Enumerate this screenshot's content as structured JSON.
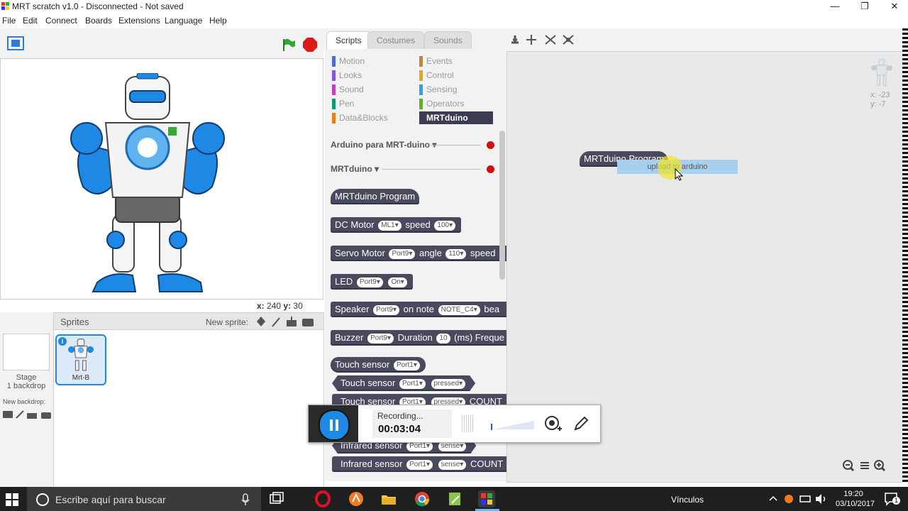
{
  "window": {
    "title": "MRT scratch v1.0 - Disconnected - Not saved",
    "minimize": "—",
    "restore": "❐",
    "close": "✕"
  },
  "menu": [
    "File",
    "Edit",
    "Connect",
    "Boards",
    "Extensions",
    "Language",
    "Help"
  ],
  "stage": {
    "coord_x_label": "x:",
    "coord_x": "240",
    "coord_y_label": "y:",
    "coord_y": "30",
    "sprite_label": "Mrt-B"
  },
  "sprites": {
    "header": "Sprites",
    "new_sprite": "New sprite:",
    "stage_name": "Stage",
    "stage_backdrops": "1 backdrop",
    "new_backdrop": "New backdrop:",
    "sprite_name": "Mrt-B",
    "info_badge": "i"
  },
  "tabs": [
    "Scripts",
    "Costumes",
    "Sounds"
  ],
  "categories_left": [
    {
      "label": "Motion",
      "color": "#4a6cd4"
    },
    {
      "label": "Looks",
      "color": "#8a55d7"
    },
    {
      "label": "Sound",
      "color": "#bb42c3"
    },
    {
      "label": "Pen",
      "color": "#0e9a6c"
    },
    {
      "label": "Data&Blocks",
      "color": "#ee7d16"
    }
  ],
  "categories_right": [
    {
      "label": "Events",
      "color": "#c88330"
    },
    {
      "label": "Control",
      "color": "#e1a91a"
    },
    {
      "label": "Sensing",
      "color": "#2ca5e2"
    },
    {
      "label": "Operators",
      "color": "#5cb712"
    },
    {
      "label": "MRTduino",
      "color": "#3b3b52"
    }
  ],
  "palette": {
    "ext1": "Arduino para MRT-duino ▾",
    "ext2": "MRTduino ▾",
    "program": "MRTduino Program",
    "dc_motor": "DC Motor",
    "dc_port": "ML1▾",
    "dc_speed": "speed",
    "dc_speed_val": "100▾",
    "servo": "Servo Motor",
    "servo_port": "Port9▾",
    "servo_angle": "angle",
    "servo_angle_val": "110▾",
    "servo_speed": "speed",
    "led": "LED",
    "led_port": "Port9▾",
    "led_state": "On▾",
    "speaker": "Speaker",
    "speaker_port": "Port9▾",
    "speaker_note": "on note",
    "speaker_note_val": "NOTE_C4▾",
    "speaker_beat": "bea",
    "buzzer": "Buzzer",
    "buzzer_port": "Port9▾",
    "buzzer_dur": "Duration",
    "buzzer_dur_val": "10",
    "buzzer_ms": "(ms) Freque",
    "touch1": "Touch sensor",
    "touch1_port": "Port1▾",
    "touch2": "Touch sensor",
    "touch2_port": "Port1▾",
    "touch2_state": "pressed▾",
    "touch3": "Touch sensor",
    "touch3_port": "Port1▾",
    "touch3_state": "pressed▾",
    "touch3_count": "COUNT",
    "ir1": "Infrared sensor",
    "ir1_port": "Port1▾",
    "ir1_sense": "sense▾",
    "ir2": "Infrared sensor",
    "ir2_port": "Port1▾",
    "ir2_sense": "sense▾",
    "ir2_count": "COUNT"
  },
  "script_area": {
    "block": "MRTduino Program",
    "context_menu": "upload to arduino",
    "sprite_x": "x: -23",
    "sprite_y": "y: -7"
  },
  "recorder": {
    "status": "Recording...",
    "time": "00:03:04"
  },
  "taskbar": {
    "search": "Escribe aquí para buscar",
    "links": "Vínculos",
    "time": "19:20",
    "date": "03/10/2017",
    "notif": "1"
  }
}
